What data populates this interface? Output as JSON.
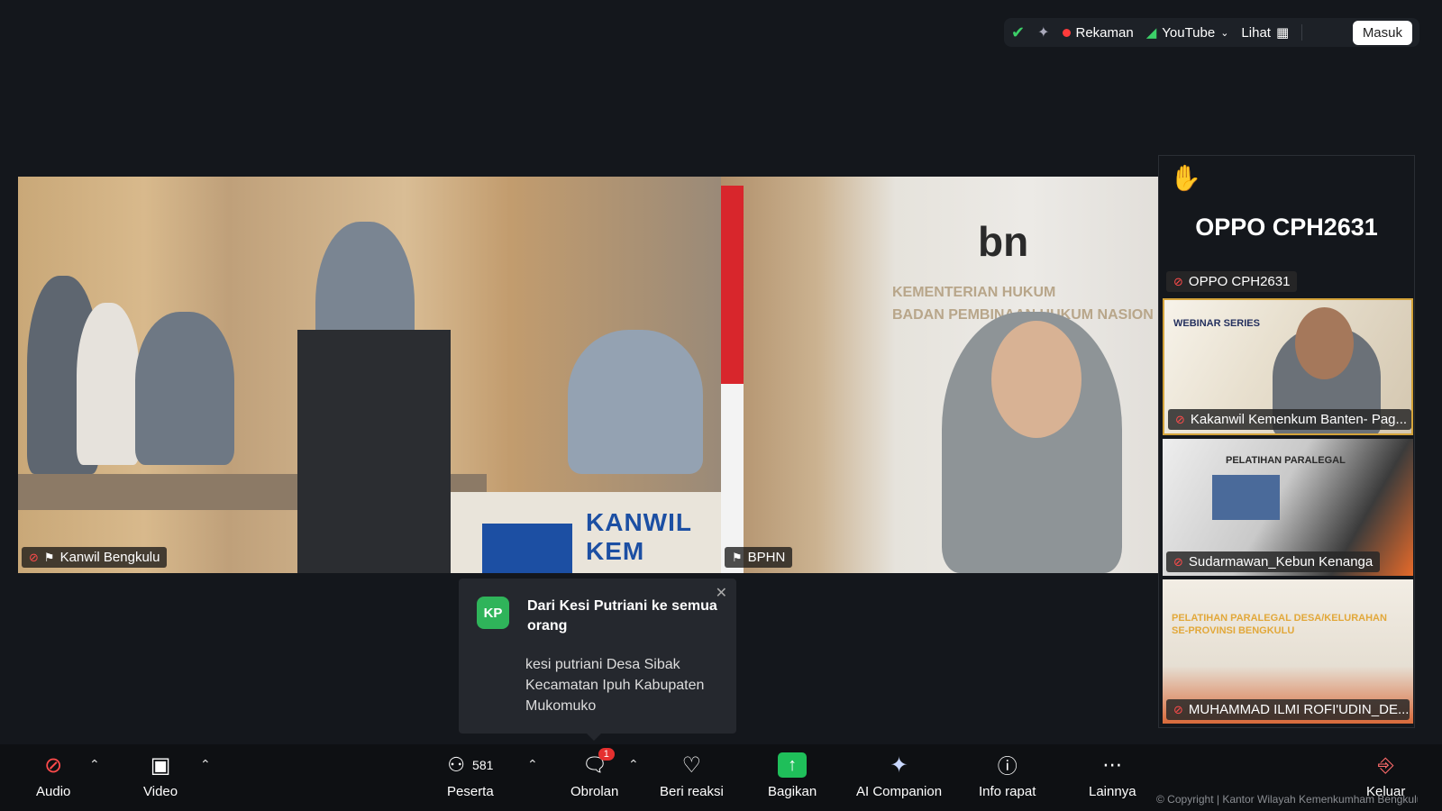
{
  "topbar": {
    "recording_label": "Rekaman",
    "stream_label": "YouTube",
    "view_label": "Lihat",
    "signin_label": "Masuk"
  },
  "main_video": {
    "left": {
      "name": "Kanwil Bengkulu",
      "desk_text": "KANWIL KEM"
    },
    "middle": {
      "name": "BPHN",
      "logo": "bn",
      "wall_title": "KEMENTERIAN HUKUM",
      "wall_sub": "BADAN PEMBINAAN HUKUM NASION"
    }
  },
  "right_panel": {
    "featured_name": "OPPO CPH2631",
    "featured_tag": "OPPO CPH2631",
    "tiles": [
      {
        "name": "Kakanwil Kemenkum Banten- Pag...",
        "caption": "WEBINAR SERIES"
      },
      {
        "name": "Sudarmawan_Kebun Kenanga",
        "caption": "PELATIHAN PARALEGAL"
      },
      {
        "name": "MUHAMMAD ILMI ROFI'UDIN_DE...",
        "caption": "PELATIHAN PARALEGAL DESA/KELURAHAN SE-PROVINSI BENGKULU"
      }
    ]
  },
  "chat_notification": {
    "avatar_initials": "KP",
    "from": "Dari Kesi Putriani ke semua orang",
    "message": "kesi putriani Desa Sibak Kecamatan Ipuh Kabupaten Mukomuko"
  },
  "toolbar": {
    "audio": "Audio",
    "video": "Video",
    "participants": "Peserta",
    "participants_count": "581",
    "chat": "Obrolan",
    "chat_badge": "1",
    "react": "Beri reaksi",
    "share": "Bagikan",
    "ai": "AI Companion",
    "info": "Info rapat",
    "more": "Lainnya",
    "leave": "Keluar"
  },
  "copyright": "© Copyright | Kantor Wilayah Kemenkumham Bengkulu"
}
